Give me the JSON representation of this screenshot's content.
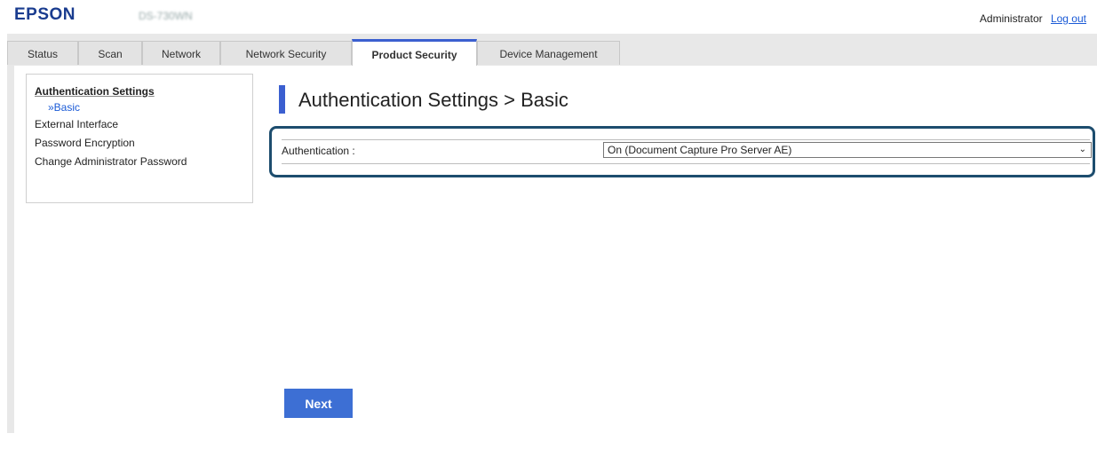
{
  "header": {
    "logo": "EPSON",
    "model": "DS-730WN",
    "user_label": "Administrator",
    "logout_label": "Log out"
  },
  "tabs": [
    {
      "label": "Status"
    },
    {
      "label": "Scan"
    },
    {
      "label": "Network"
    },
    {
      "label": "Network Security"
    },
    {
      "label": "Product Security",
      "active": true
    },
    {
      "label": "Device Management"
    }
  ],
  "sidebar": {
    "heading": "Authentication Settings",
    "sub_item": "»Basic",
    "items": [
      {
        "label": "External Interface"
      },
      {
        "label": "Password Encryption"
      },
      {
        "label": "Change Administrator Password"
      }
    ]
  },
  "main": {
    "title": "Authentication Settings > Basic",
    "authentication_label": "Authentication :",
    "authentication_value": "On (Document Capture Pro Server AE)",
    "next_label": "Next"
  },
  "colors": {
    "accent": "#3b5fd0",
    "highlight_border": "#1d4d6e",
    "button": "#3d6fd4"
  }
}
